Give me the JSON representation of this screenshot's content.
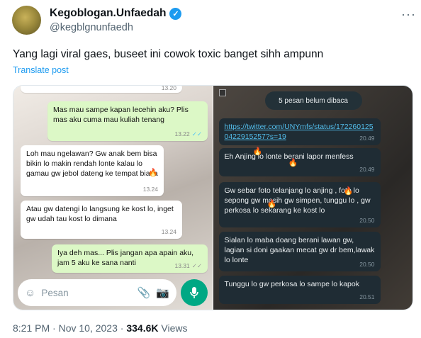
{
  "header": {
    "display_name": "Kegoblogan.Unfaedah",
    "handle": "@kegblgnunfaedh",
    "more_icon": "more-icon",
    "verified_icon": "verified-badge-icon"
  },
  "tweet": {
    "text": "Yang lagi viral gaes, buseet ini cowok toxic banget sihh ampunn",
    "translate_label": "Translate post"
  },
  "left_chat": {
    "top_time": "13.20",
    "messages": [
      {
        "side": "out",
        "text": "Mas mau sampe kapan lecehin aku? Plis mas aku cuma mau kuliah tenang",
        "time": "13.22"
      },
      {
        "side": "in",
        "text": "Loh mau ngelawan? Gw anak bem bisa bikin lo makin rendah lonte kalau lo gamau gw jebol dateng ke tempat biasa",
        "time": "13.24"
      },
      {
        "side": "in",
        "text": "Atau gw datengi lo langsung ke kost lo, inget gw udah tau kost lo dimana",
        "time": "13.24"
      },
      {
        "side": "out",
        "text": "Iya deh mas... Plis jangan apa apain aku, jam 5 aku ke sana nanti",
        "time": "13.31"
      }
    ],
    "input_placeholder": "Pesan"
  },
  "right_chat": {
    "banner": "5 pesan belum dibaca",
    "messages": [
      {
        "text": "https://twitter.com/UNYmfs/status/1722601250422915257?s=19",
        "time": "20.49",
        "is_link": true
      },
      {
        "text": "Eh Anjing lo lonte berani lapor menfess",
        "time": "20.49"
      },
      {
        "text": "Gw sebar foto telanjang lo anjing , foto lo sepong gw masih gw simpen, tunggu lo , gw perkosa lo sekarang ke kost lo",
        "time": "20.50"
      },
      {
        "text": "Sialan lo maba doang berani lawan gw, lagian si doni gaakan mecat gw dr bem,lawak lo lonte",
        "time": "20.50"
      },
      {
        "text": "Tunggu lo gw perkosa lo sampe lo kapok",
        "time": "20.51"
      }
    ]
  },
  "footer": {
    "time": "8:21 PM",
    "sep1": "·",
    "date": "Nov 10, 2023",
    "sep2": "·",
    "views_count": "334.6K",
    "views_label": "Views"
  },
  "colors": {
    "accent": "#1d9bf0",
    "whatsapp_green": "#00a884",
    "outgoing_bubble": "#dcf8c6",
    "dark_bubble": "#1f2c34"
  }
}
